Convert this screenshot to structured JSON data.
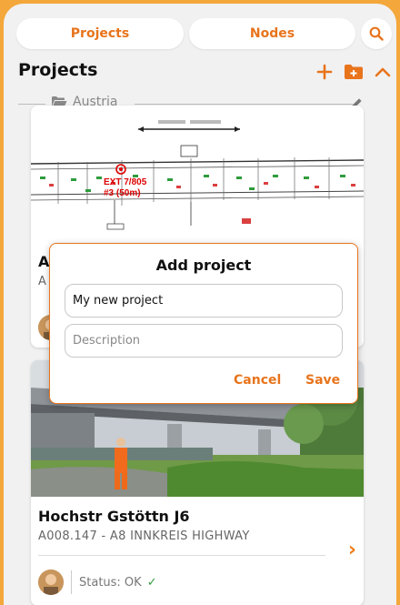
{
  "tabs": {
    "projects_label": "Projects",
    "nodes_label": "Nodes"
  },
  "section": {
    "title": "Projects"
  },
  "group": {
    "name": "Austria"
  },
  "dialog": {
    "title": "Add project",
    "name_value": "My new project",
    "description_placeholder": "Description",
    "cancel_label": "Cancel",
    "save_label": "Save"
  },
  "plan_annotation": {
    "line1": "EXT 7/805",
    "line2": "#3 (50m)"
  },
  "card1": {
    "title_fragment": "A",
    "subtitle_fragment": "A"
  },
  "card2": {
    "title": "Hochstr Gstöttn J6",
    "subtitle": "A008.147 - A8 INNKREIS HIGHWAY",
    "status": "Status: OK"
  },
  "colors": {
    "accent": "#e8741c",
    "background_frame": "#f4a73a",
    "ok": "#2e9c3d"
  },
  "icons": [
    "search-icon",
    "plus-icon",
    "folder-plus-icon",
    "chevron-up-icon",
    "folder-open-icon",
    "pencil-icon",
    "chevron-right-icon",
    "checkmark-icon"
  ]
}
